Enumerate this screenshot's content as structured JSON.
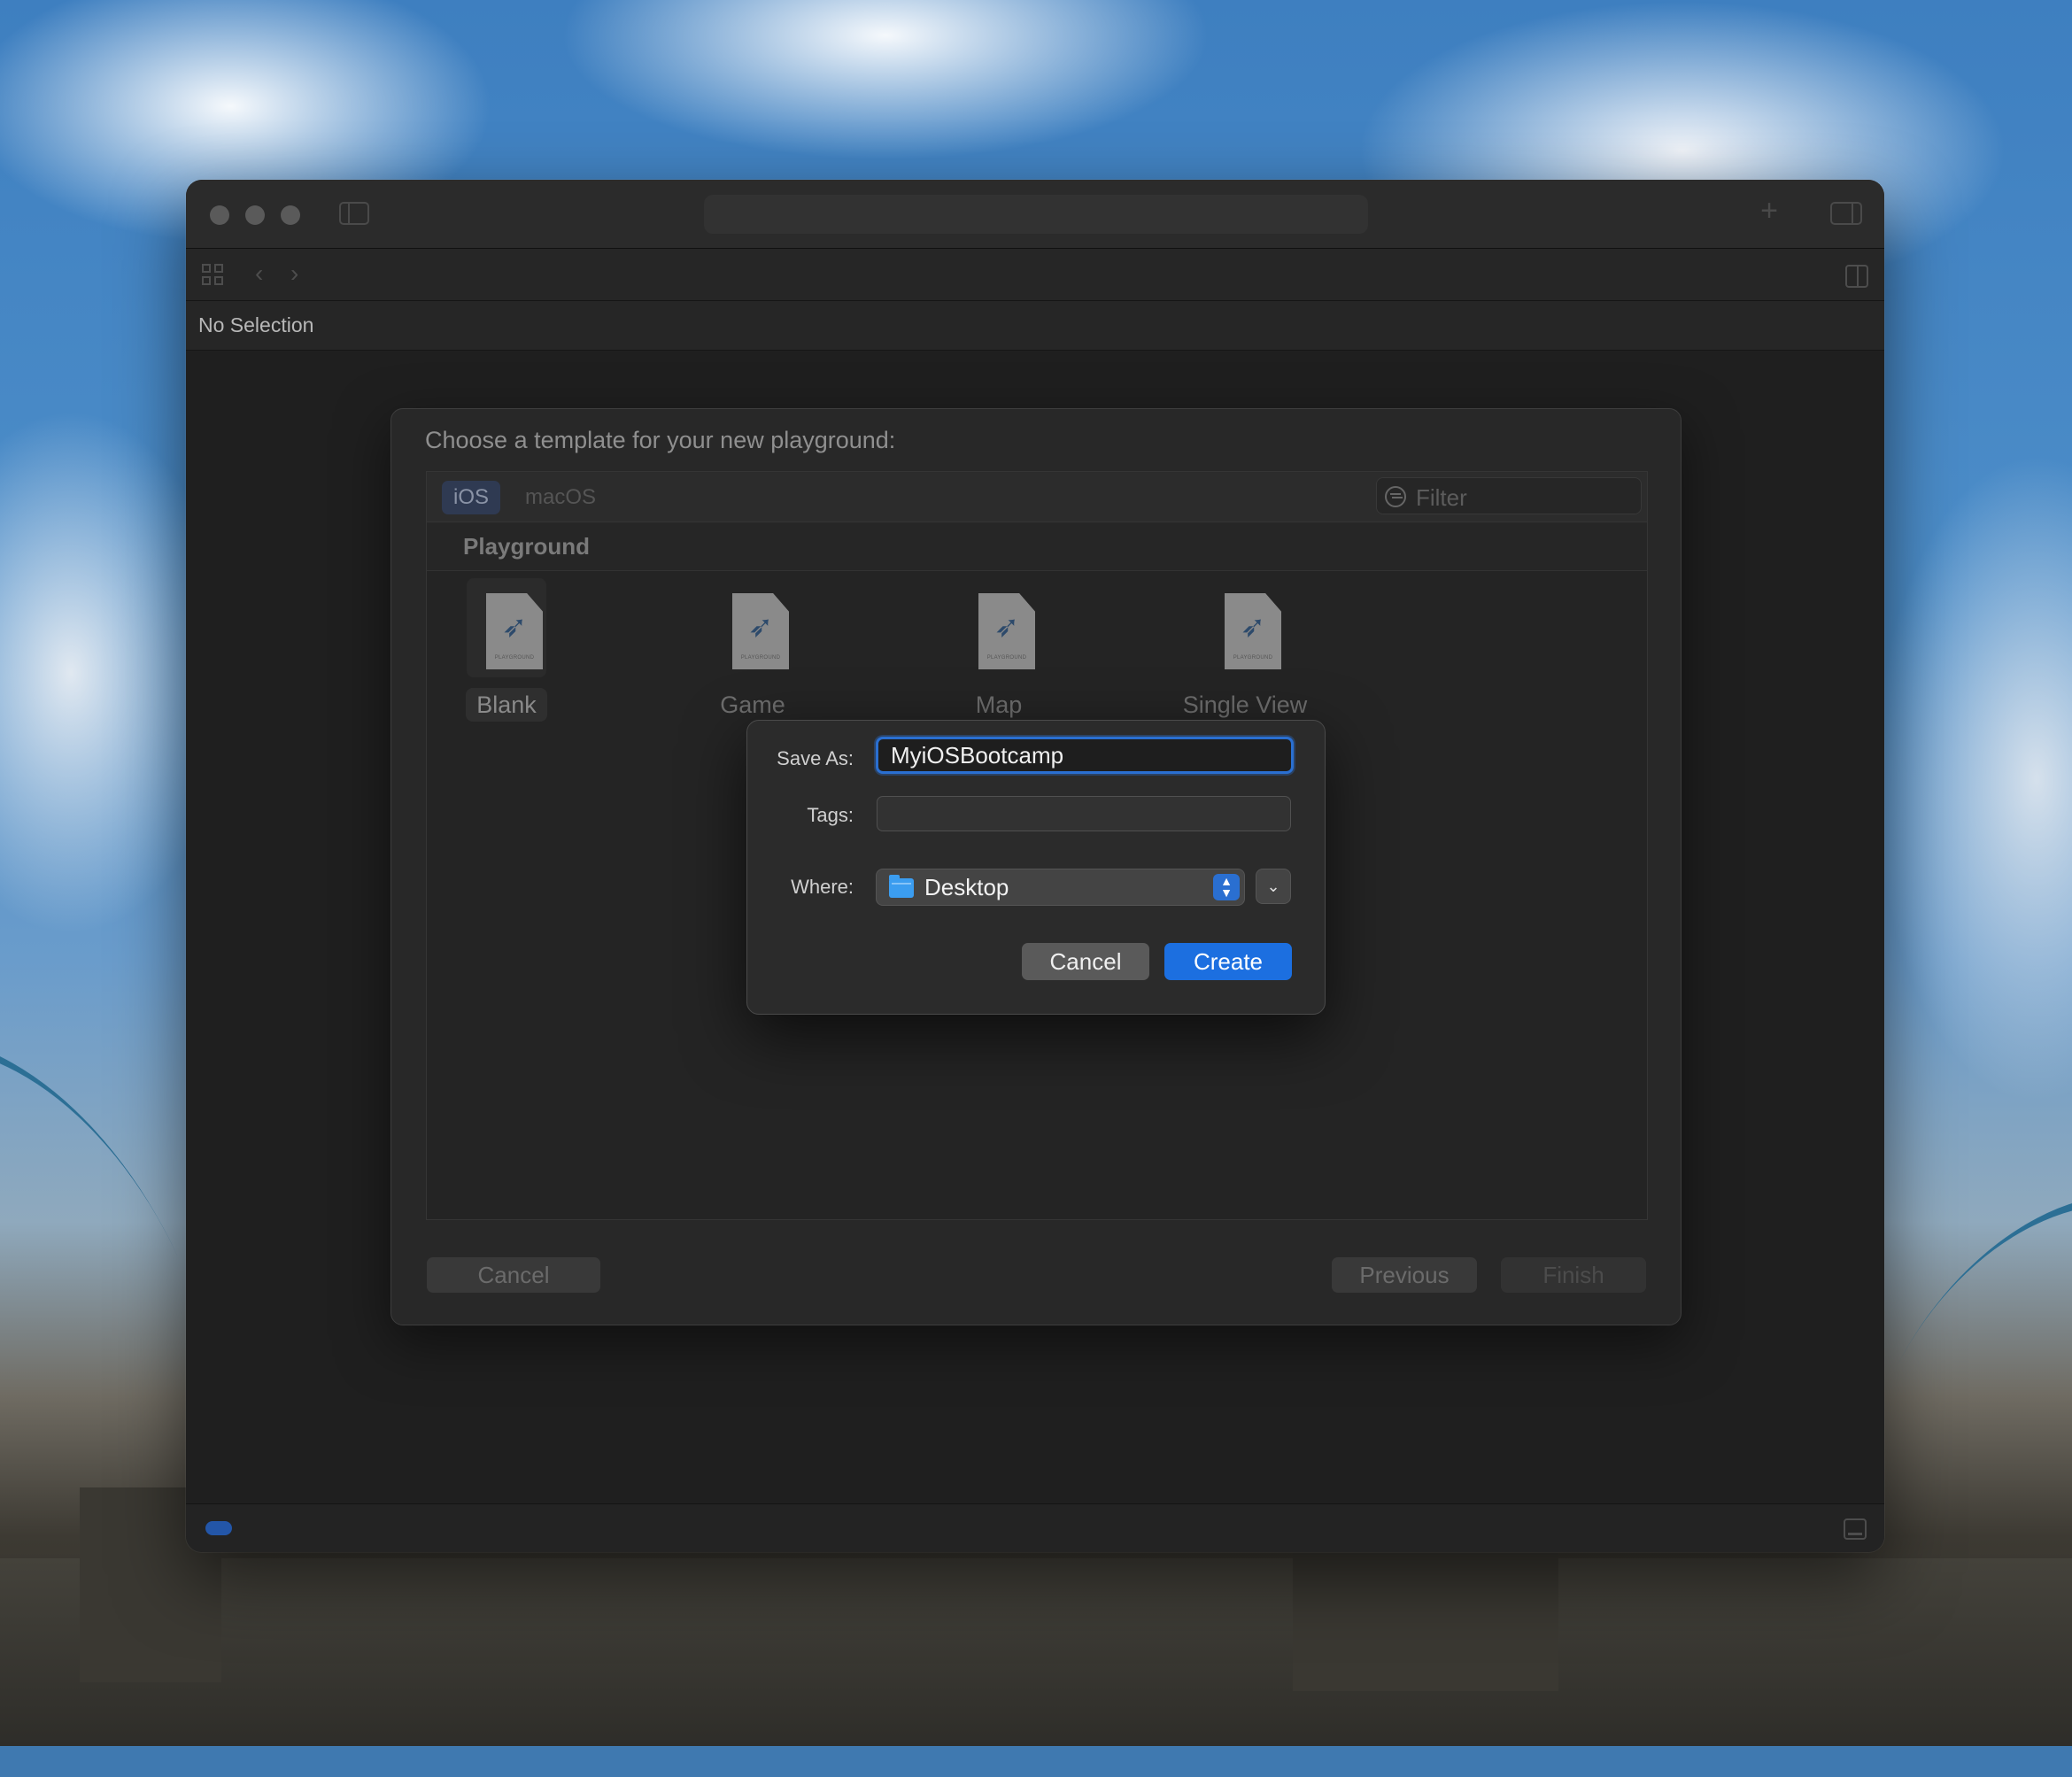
{
  "window": {
    "jumpbar_text": "No Selection"
  },
  "template_sheet": {
    "title": "Choose a template for your new playground:",
    "platform_tabs": [
      {
        "label": "iOS",
        "selected": true
      },
      {
        "label": "macOS",
        "selected": false
      }
    ],
    "filter_placeholder": "Filter",
    "section_title": "Playground",
    "templates": [
      {
        "label": "Blank",
        "selected": true,
        "badge": "PLAYGROUND"
      },
      {
        "label": "Game",
        "selected": false,
        "badge": "PLAYGROUND"
      },
      {
        "label": "Map",
        "selected": false,
        "badge": "PLAYGROUND"
      },
      {
        "label": "Single View",
        "selected": false,
        "badge": "PLAYGROUND"
      }
    ],
    "buttons": {
      "cancel": "Cancel",
      "previous": "Previous",
      "finish": "Finish"
    }
  },
  "save_dialog": {
    "save_as_label": "Save As:",
    "save_as_value": "MyiOSBootcamp",
    "tags_label": "Tags:",
    "tags_value": "",
    "where_label": "Where:",
    "where_value": "Desktop",
    "cancel_label": "Cancel",
    "create_label": "Create"
  },
  "colors": {
    "accent": "#1c6fe0",
    "focus_ring": "#2a6fd1",
    "folder": "#3b9df0"
  }
}
